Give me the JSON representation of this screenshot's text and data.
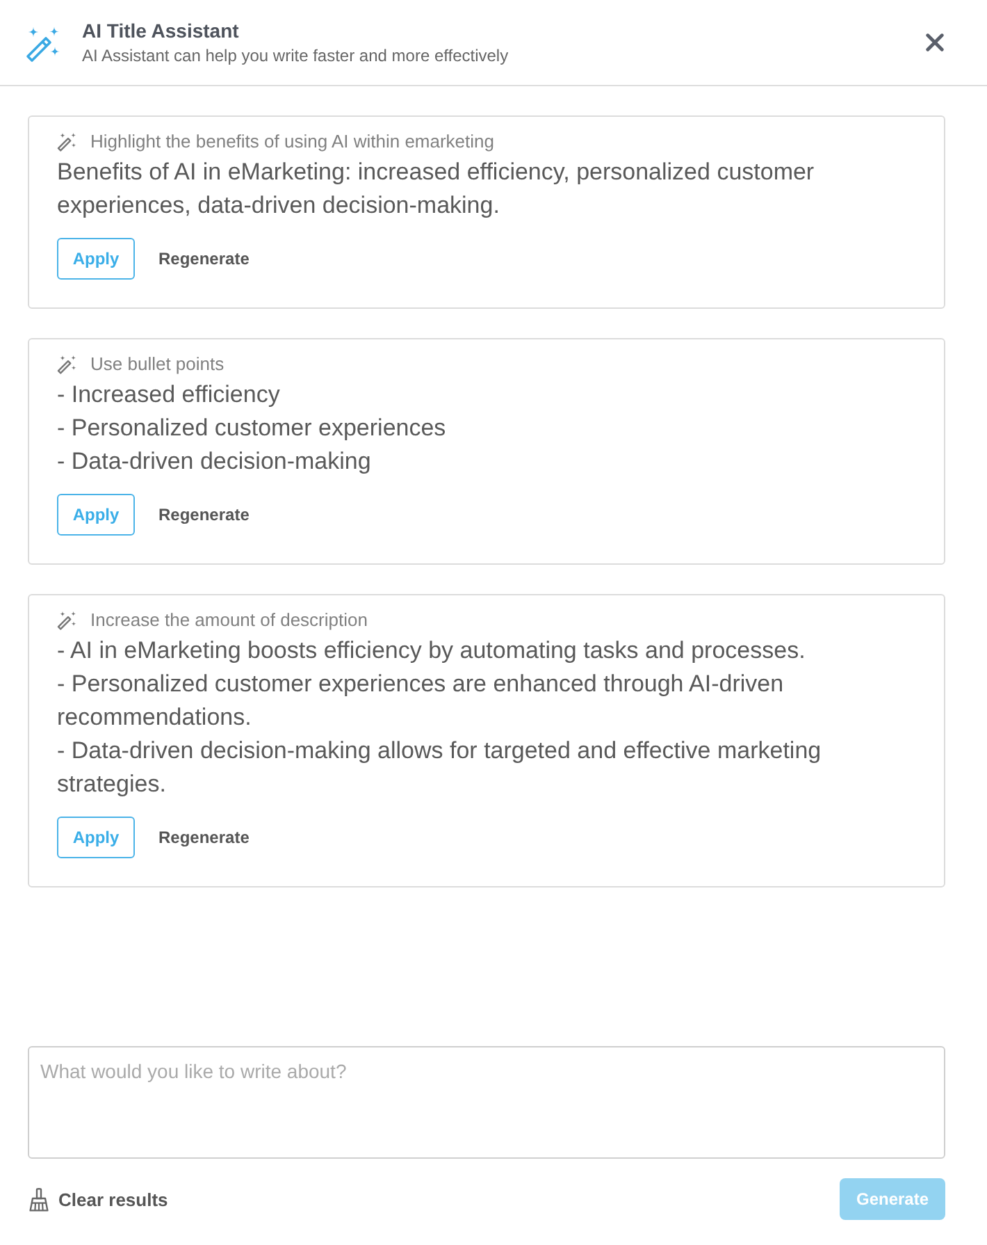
{
  "header": {
    "title": "AI Title Assistant",
    "subtitle": "AI Assistant can help you write faster and more effectively"
  },
  "results": [
    {
      "prompt": "Highlight the benefits of using AI within emarketing",
      "lines": [
        "Benefits of AI in eMarketing: increased efficiency, personalized customer experiences, data-driven decision-making."
      ],
      "apply": "Apply",
      "regenerate": "Regenerate"
    },
    {
      "prompt": "Use bullet points",
      "lines": [
        "- Increased efficiency",
        "- Personalized customer experiences",
        "- Data-driven decision-making"
      ],
      "apply": "Apply",
      "regenerate": "Regenerate"
    },
    {
      "prompt": "Increase the amount of description",
      "lines": [
        "- AI in eMarketing boosts efficiency by automating tasks and processes.",
        "- Personalized customer experiences are enhanced through AI-driven recommendations.",
        "- Data-driven decision-making allows for targeted and effective marketing strategies."
      ],
      "apply": "Apply",
      "regenerate": "Regenerate"
    }
  ],
  "input": {
    "placeholder": "What would you like to write about?"
  },
  "footer": {
    "clear": "Clear results",
    "generate": {
      "label": "Generate",
      "disabled": true
    }
  }
}
